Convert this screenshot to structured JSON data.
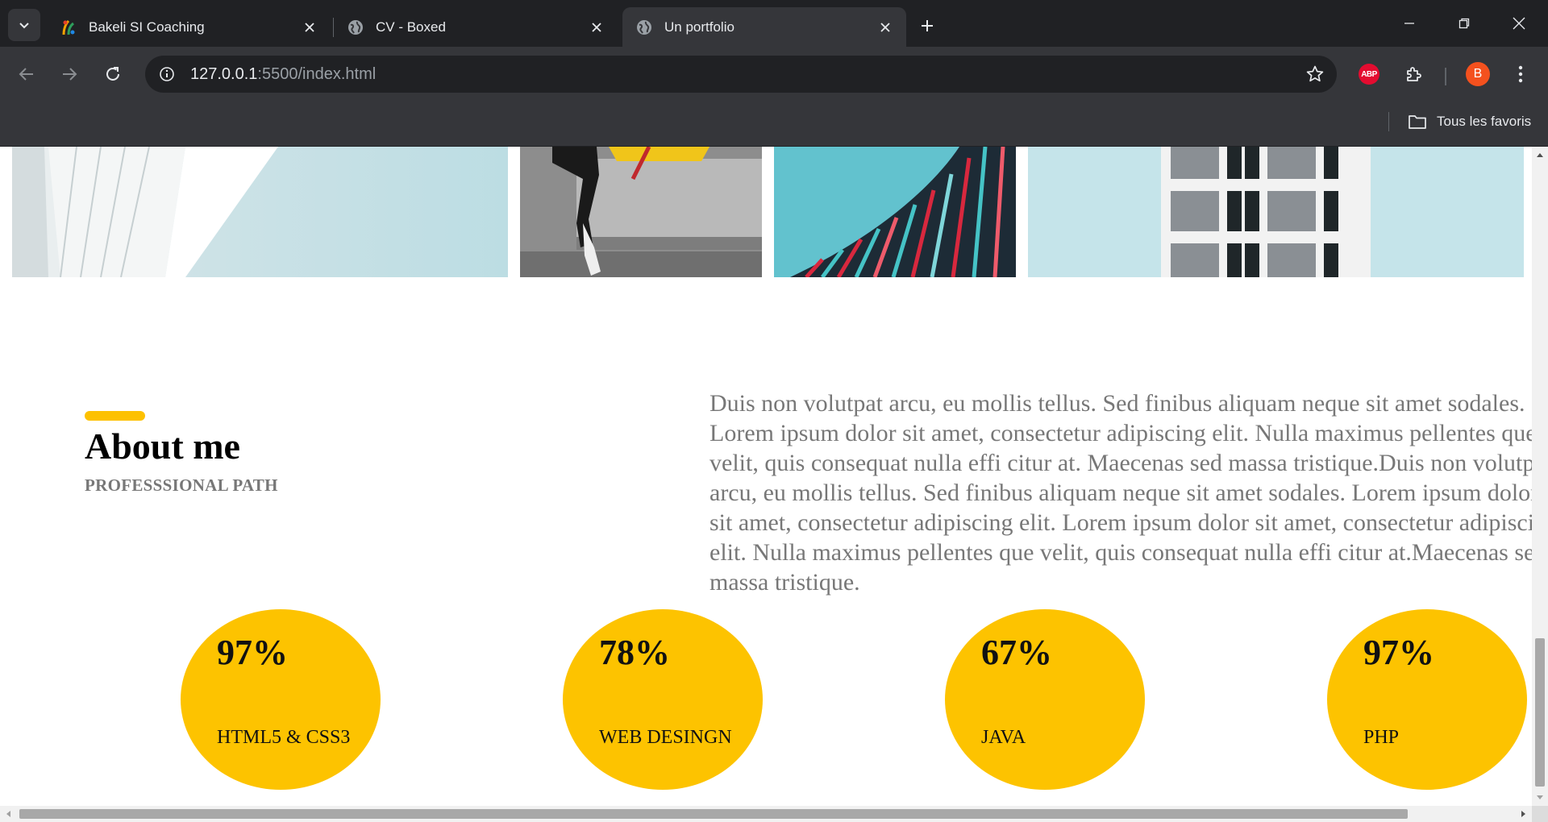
{
  "browser": {
    "tabs": [
      {
        "title": "Bakeli SI Coaching",
        "active": false,
        "favicon": "bakeli-logo-icon"
      },
      {
        "title": "CV - Boxed",
        "active": false,
        "favicon": "globe-icon"
      },
      {
        "title": "Un portfolio",
        "active": true,
        "favicon": "globe-icon"
      }
    ],
    "url": {
      "host": "127.0.0.1",
      "path": ":5500/index.html"
    },
    "profile_initial": "B",
    "extension_abp_label": "ABP",
    "bookmarks_folder": "Tous les favoris"
  },
  "page": {
    "about": {
      "title": "About me",
      "subtitle": "PROFESSSIONAL PATH",
      "text": "Duis non volutpat arcu, eu mollis tellus. Sed finibus aliquam neque sit amet sodales. Lorem ipsum dolor sit amet, consectetur adipiscing elit. Nulla maximus pellentes que velit, quis consequat nulla effi citur at. Maecenas sed massa tristique.Duis non volutpat arcu, eu mollis tellus. Sed finibus aliquam neque sit amet sodales. Lorem ipsum dolor sit amet, consectetur adipiscing elit. Lorem ipsum dolor sit amet, consectetur adipiscing elit. Nulla maximus pellentes que velit, quis consequat nulla effi citur at.Maecenas sed massa tristique."
    },
    "skills": [
      {
        "percent": "97%",
        "name": "HTML5 & CSS3"
      },
      {
        "percent": "78%",
        "name": "WEB DESINGN"
      },
      {
        "percent": "67%",
        "name": "JAVA"
      },
      {
        "percent": "97%",
        "name": "PHP"
      }
    ]
  },
  "colors": {
    "accent": "#fdc300",
    "chrome_dark": "#202124",
    "chrome_toolbar": "#35363a",
    "text_gray": "#777777"
  }
}
